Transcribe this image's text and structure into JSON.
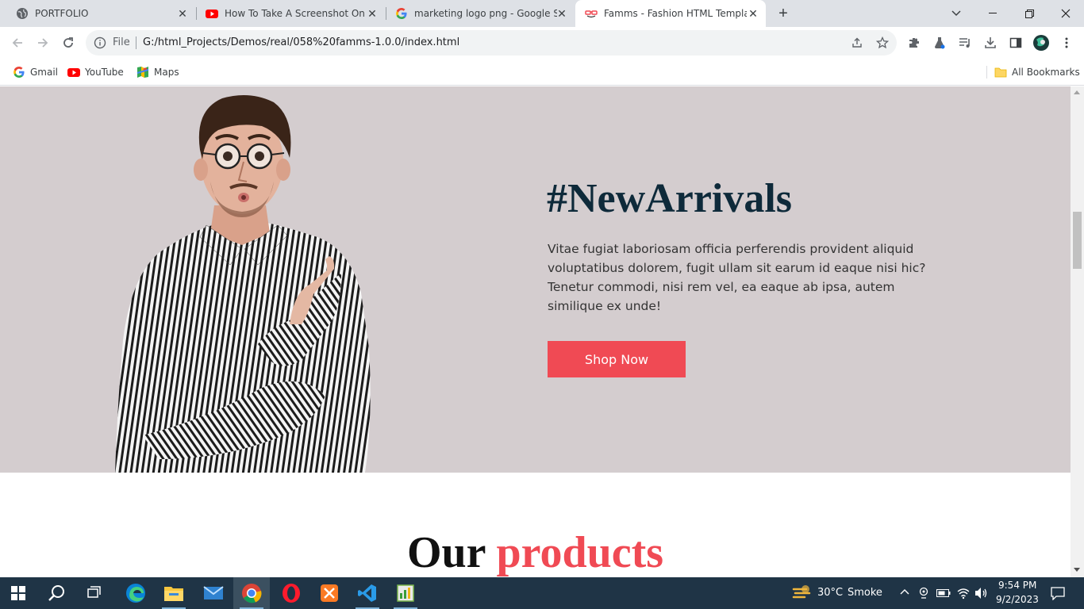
{
  "browser": {
    "tabs": [
      {
        "title": "PORTFOLIO",
        "icon": "globe-icon",
        "active": false
      },
      {
        "title": "How To Take A Screenshot On Yo",
        "icon": "youtube-icon",
        "active": false
      },
      {
        "title": "marketing logo png - Google Se",
        "icon": "google-icon",
        "active": false
      },
      {
        "title": "Famms - Fashion HTML Templat",
        "icon": "famms-icon",
        "active": true
      }
    ],
    "omnibox": {
      "scheme": "File",
      "url": "G:/html_Projects/Demos/real/058%20famms-1.0.0/index.html"
    },
    "bookmarks": [
      {
        "label": "Gmail",
        "icon": "google-icon"
      },
      {
        "label": "YouTube",
        "icon": "youtube-icon"
      },
      {
        "label": "Maps",
        "icon": "maps-icon"
      }
    ],
    "all_bookmarks": "All Bookmarks"
  },
  "page": {
    "hero": {
      "title": "#NewArrivals",
      "text": "Vitae fugiat laboriosam officia perferendis provident aliquid voluptatibus dolorem, fugit ullam sit earum id eaque nisi hic? Tenetur commodi, nisi rem vel, ea eaque ab ipsa, autem similique ex unde!",
      "button": "Shop Now",
      "accent_color": "#f04a54",
      "background": "#d4cdcf",
      "title_color": "#0e2a3a"
    },
    "products": {
      "heading_part1": "Our",
      "heading_part2": "products"
    }
  },
  "taskbar": {
    "weather": {
      "temp": "30°C",
      "condition": "Smoke"
    },
    "clock": {
      "time": "9:54 PM",
      "date": "9/2/2023"
    }
  }
}
